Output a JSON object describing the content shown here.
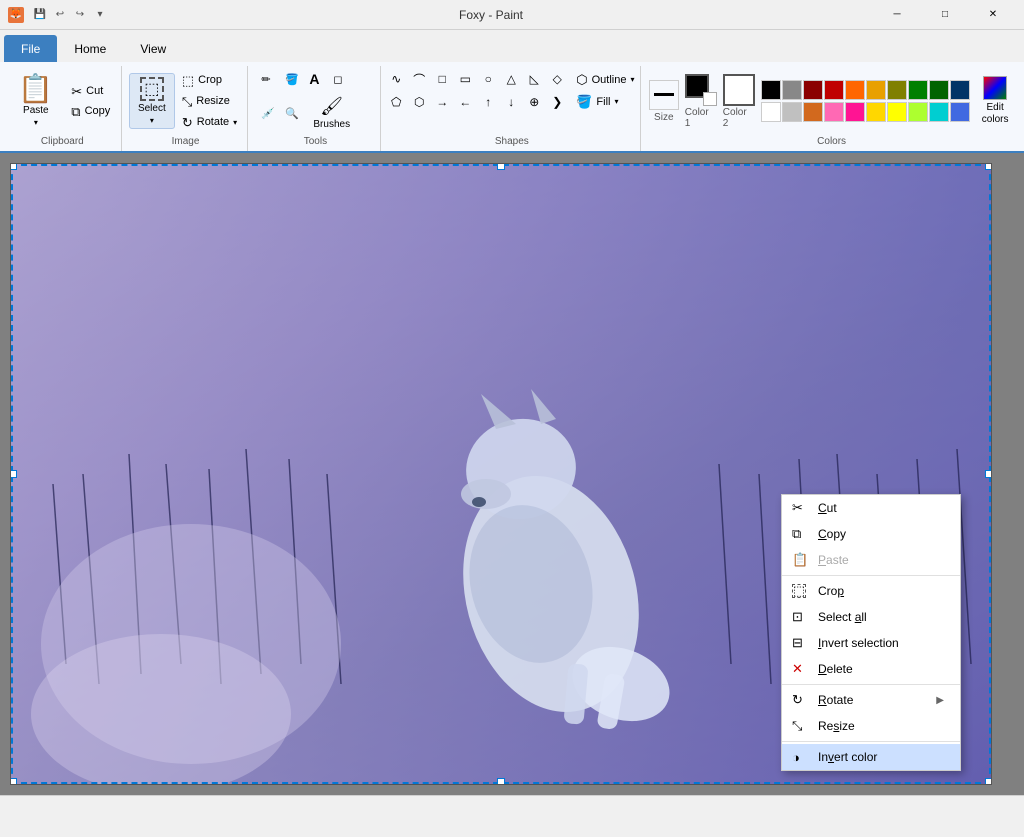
{
  "titlebar": {
    "title": "Foxy - Paint",
    "icon_label": "F"
  },
  "tabs": [
    {
      "id": "file",
      "label": "File",
      "active": true
    },
    {
      "id": "home",
      "label": "Home",
      "active": false
    },
    {
      "id": "view",
      "label": "View",
      "active": false
    }
  ],
  "ribbon": {
    "groups": [
      {
        "id": "clipboard",
        "label": "Clipboard",
        "buttons": [
          {
            "id": "paste",
            "label": "Paste",
            "icon": "📋"
          },
          {
            "id": "cut",
            "label": "Cut",
            "icon": "✂"
          },
          {
            "id": "copy",
            "label": "Copy",
            "icon": "⧉"
          }
        ]
      },
      {
        "id": "image",
        "label": "Image",
        "buttons": [
          {
            "id": "crop",
            "label": "Crop",
            "icon": "⬚"
          },
          {
            "id": "resize",
            "label": "Resize",
            "icon": "⤡"
          },
          {
            "id": "rotate",
            "label": "Rotate",
            "icon": "↻"
          }
        ]
      },
      {
        "id": "tools",
        "label": "Tools",
        "buttons": [
          {
            "id": "pencil",
            "label": "",
            "icon": "✏"
          },
          {
            "id": "fill",
            "label": "",
            "icon": "🪣"
          },
          {
            "id": "text",
            "label": "",
            "icon": "A"
          },
          {
            "id": "eraser",
            "label": "",
            "icon": "◻"
          },
          {
            "id": "picker",
            "label": "",
            "icon": "💉"
          },
          {
            "id": "magnify",
            "label": "",
            "icon": "🔍"
          },
          {
            "id": "brushes",
            "label": "Brushes",
            "icon": "🖌"
          }
        ]
      },
      {
        "id": "shapes",
        "label": "Shapes",
        "outline_label": "Outline",
        "fill_label": "Fill"
      },
      {
        "id": "colors",
        "label": "Colors",
        "size_label": "Size",
        "color1_label": "Color 1",
        "color2_label": "Color 2",
        "swatches": [
          "#000000",
          "#888888",
          "#8b0000",
          "#c00000",
          "#ff6600",
          "#ffd700",
          "#808000",
          "#008000",
          "#006400",
          "#003366",
          "#ffffff",
          "#c0c0c0",
          "#d2691e",
          "#ff69b4",
          "#ff1493",
          "#ffd700",
          "#ffff00",
          "#adff2f",
          "#00ced1",
          "#4169e1"
        ]
      }
    ],
    "select_btn_label": "Select"
  },
  "context_menu": {
    "items": [
      {
        "id": "cut",
        "label": "Cut",
        "icon": "✂",
        "shortcut": "",
        "disabled": false
      },
      {
        "id": "copy",
        "label": "Copy",
        "icon": "⧉",
        "shortcut": "",
        "disabled": false
      },
      {
        "id": "paste",
        "label": "Paste",
        "icon": "📋",
        "shortcut": "",
        "disabled": true
      },
      {
        "id": "crop",
        "label": "Crop",
        "icon": "⬚",
        "shortcut": "",
        "disabled": false
      },
      {
        "id": "select-all",
        "label": "Select all",
        "icon": "⊡",
        "shortcut": "",
        "disabled": false
      },
      {
        "id": "invert-selection",
        "label": "Invert selection",
        "icon": "⊟",
        "shortcut": "",
        "disabled": false
      },
      {
        "id": "delete",
        "label": "Delete",
        "icon": "✕",
        "shortcut": "",
        "disabled": false
      },
      {
        "id": "rotate",
        "label": "Rotate",
        "icon": "↻",
        "shortcut": "",
        "disabled": false,
        "has_submenu": true
      },
      {
        "id": "resize",
        "label": "Resize",
        "icon": "⤡",
        "shortcut": "",
        "disabled": false
      },
      {
        "id": "invert-color",
        "label": "Invert color",
        "icon": "◑",
        "shortcut": "",
        "disabled": false,
        "highlighted": true
      }
    ]
  },
  "status": {
    "coords": "",
    "size": ""
  }
}
